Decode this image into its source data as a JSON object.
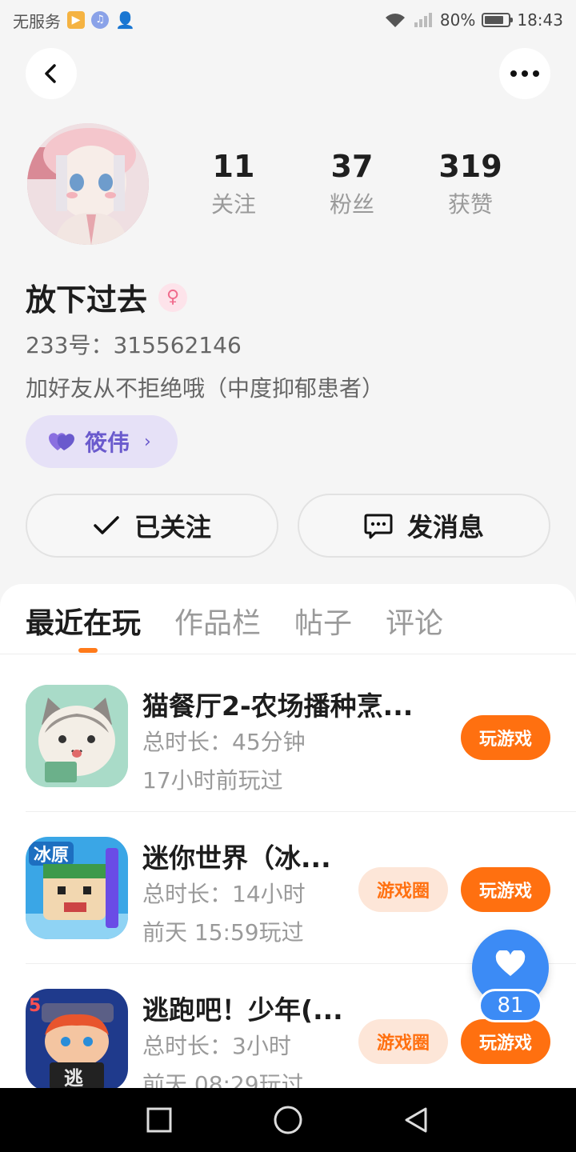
{
  "status_bar": {
    "carrier": "无服务",
    "battery_text": "80%",
    "battery_level": 0.8,
    "time": "18:43"
  },
  "header": {
    "back_icon": "back-arrow-icon",
    "more_icon": "more-dots-icon"
  },
  "profile": {
    "stats": [
      {
        "value": "11",
        "label": "关注"
      },
      {
        "value": "37",
        "label": "粉丝"
      },
      {
        "value": "319",
        "label": "获赞"
      }
    ],
    "nickname": "放下过去",
    "gender_icon": "female-icon",
    "uid": "233号：315562146",
    "bio": "加好友从不拒绝哦（中度抑郁患者）",
    "cp_name": "筱伟",
    "accent_purple": "#6a5acd"
  },
  "actions": {
    "follow_label": "已关注",
    "message_label": "发消息"
  },
  "tabs": [
    "最近在玩",
    "作品栏",
    "帖子",
    "评论"
  ],
  "games": [
    {
      "name": "猫餐厅2-农场播种烹...",
      "duration": "总时长：45分钟",
      "last_played": "17小时前玩过",
      "circle_label": "",
      "play_label": "玩游戏"
    },
    {
      "name": "迷你世界（冰...",
      "duration": "总时长：14小时",
      "last_played": "前天 15:59玩过",
      "circle_label": "游戏圈",
      "play_label": "玩游戏"
    },
    {
      "name": "逃跑吧！少年(...",
      "duration": "总时长：3小时",
      "last_played": "前天 08:29玩过",
      "circle_label": "游戏圈",
      "play_label": "玩游戏"
    }
  ],
  "like_fab": {
    "count": "81",
    "color": "#3c8bf5"
  },
  "accent_orange": "#ff7010"
}
